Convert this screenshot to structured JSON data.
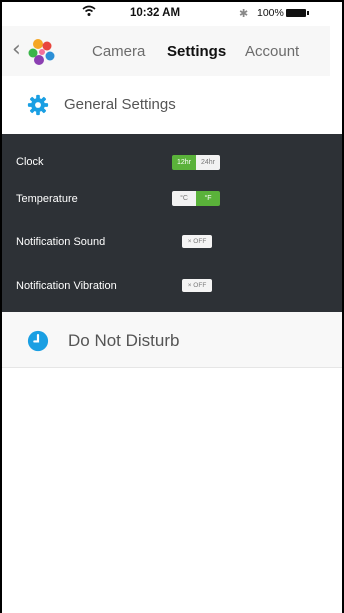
{
  "status_bar": {
    "time": "10:32 AM",
    "bluetooth_symbol": "✱",
    "battery_label": "100%",
    "icons": [
      "wifi-icon",
      "bluetooth-icon",
      "battery-icon"
    ]
  },
  "nav": {
    "back_symbol": "‹",
    "tabs": [
      {
        "label": "Camera",
        "active": false
      },
      {
        "label": "Settings",
        "active": true
      },
      {
        "label": "Account",
        "active": false
      }
    ]
  },
  "general_settings": {
    "title": "General Settings",
    "icon": "gear-icon"
  },
  "settings": {
    "clock": {
      "label": "Clock",
      "options": [
        "12hr",
        "24hr"
      ],
      "selected": "12hr"
    },
    "temperature": {
      "label": "Temperature",
      "options": [
        "°C",
        "°F"
      ],
      "selected": "°F"
    },
    "notification_sound": {
      "label": "Notification Sound",
      "toggle_text": "× OFF",
      "value": "off"
    },
    "notification_vibration": {
      "label": "Notification Vibration",
      "toggle_text": "× OFF",
      "value": "off"
    }
  },
  "do_not_disturb": {
    "title": "Do Not Disturb",
    "icon": "clock-icon"
  },
  "colors": {
    "accent_blue": "#1a9fe3",
    "toggle_green": "#5ab23a",
    "panel_dark": "#2d3136"
  }
}
